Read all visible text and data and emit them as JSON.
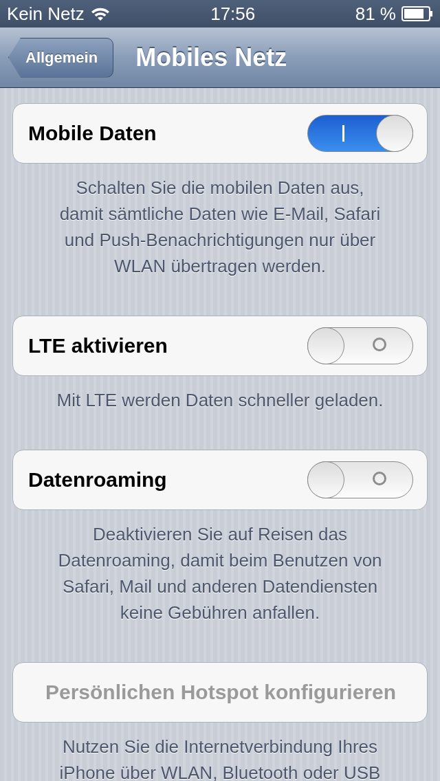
{
  "status_bar": {
    "carrier": "Kein Netz",
    "time": "17:56",
    "battery": "81 %"
  },
  "nav_bar": {
    "back_button": "Allgemein",
    "title": "Mobiles Netz"
  },
  "sections": [
    {
      "kind": "toggle",
      "label": "Mobile Daten",
      "on": true,
      "footer": [
        "Schalten Sie die mobilen Daten aus,",
        "damit sämtliche Daten wie E-Mail, Safari",
        "und Push-Benachrichtigungen nur über",
        "WLAN übertragen werden."
      ]
    },
    {
      "kind": "toggle",
      "label": "LTE aktivieren",
      "on": false,
      "footer": [
        "Mit LTE werden Daten schneller geladen."
      ]
    },
    {
      "kind": "toggle",
      "label": "Datenroaming",
      "on": false,
      "footer": [
        "Deaktivieren Sie auf Reisen das",
        "Datenroaming, damit beim Benutzen von",
        "Safari, Mail und anderen Datendiensten",
        "keine Gebühren anfallen."
      ]
    },
    {
      "kind": "button",
      "label": "Persönlichen Hotspot konfigurieren",
      "disabled": true,
      "footer": [
        "Nutzen Sie die Internetverbindung Ihres",
        "iPhone über WLAN, Bluetooth oder USB"
      ]
    }
  ]
}
